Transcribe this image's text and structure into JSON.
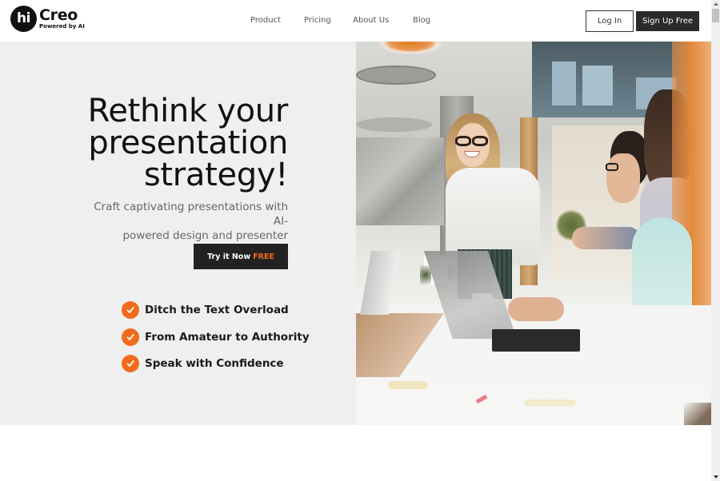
{
  "brand": {
    "logo_mark": "hi",
    "name": "Creo",
    "tagline": "Powered by AI"
  },
  "nav": {
    "items": [
      {
        "label": "Product"
      },
      {
        "label": "Pricing"
      },
      {
        "label": "About Us"
      },
      {
        "label": "Blog"
      }
    ]
  },
  "auth": {
    "login_label": "Log In",
    "signup_label": "Sign Up Free"
  },
  "hero": {
    "headline_lines": [
      "Rethink your",
      "presentation",
      "strategy!"
    ],
    "subheadline_lines": [
      "Craft captivating presentations with AI-",
      "powered design and presenter guidance."
    ],
    "cta_label": "Try it Now",
    "cta_highlight": "FREE",
    "features": [
      {
        "icon": "check-circle-icon",
        "label": "Ditch the Text Overload"
      },
      {
        "icon": "check-circle-icon",
        "label": "From Amateur to Authority"
      },
      {
        "icon": "check-circle-icon",
        "label": "Speak with Confidence"
      }
    ],
    "image_alt": "Smiling woman presenting to colleagues at an office table with laptops"
  },
  "colors": {
    "accent": "#f26a1b",
    "dark": "#222222",
    "hero_bg": "#efefef"
  }
}
